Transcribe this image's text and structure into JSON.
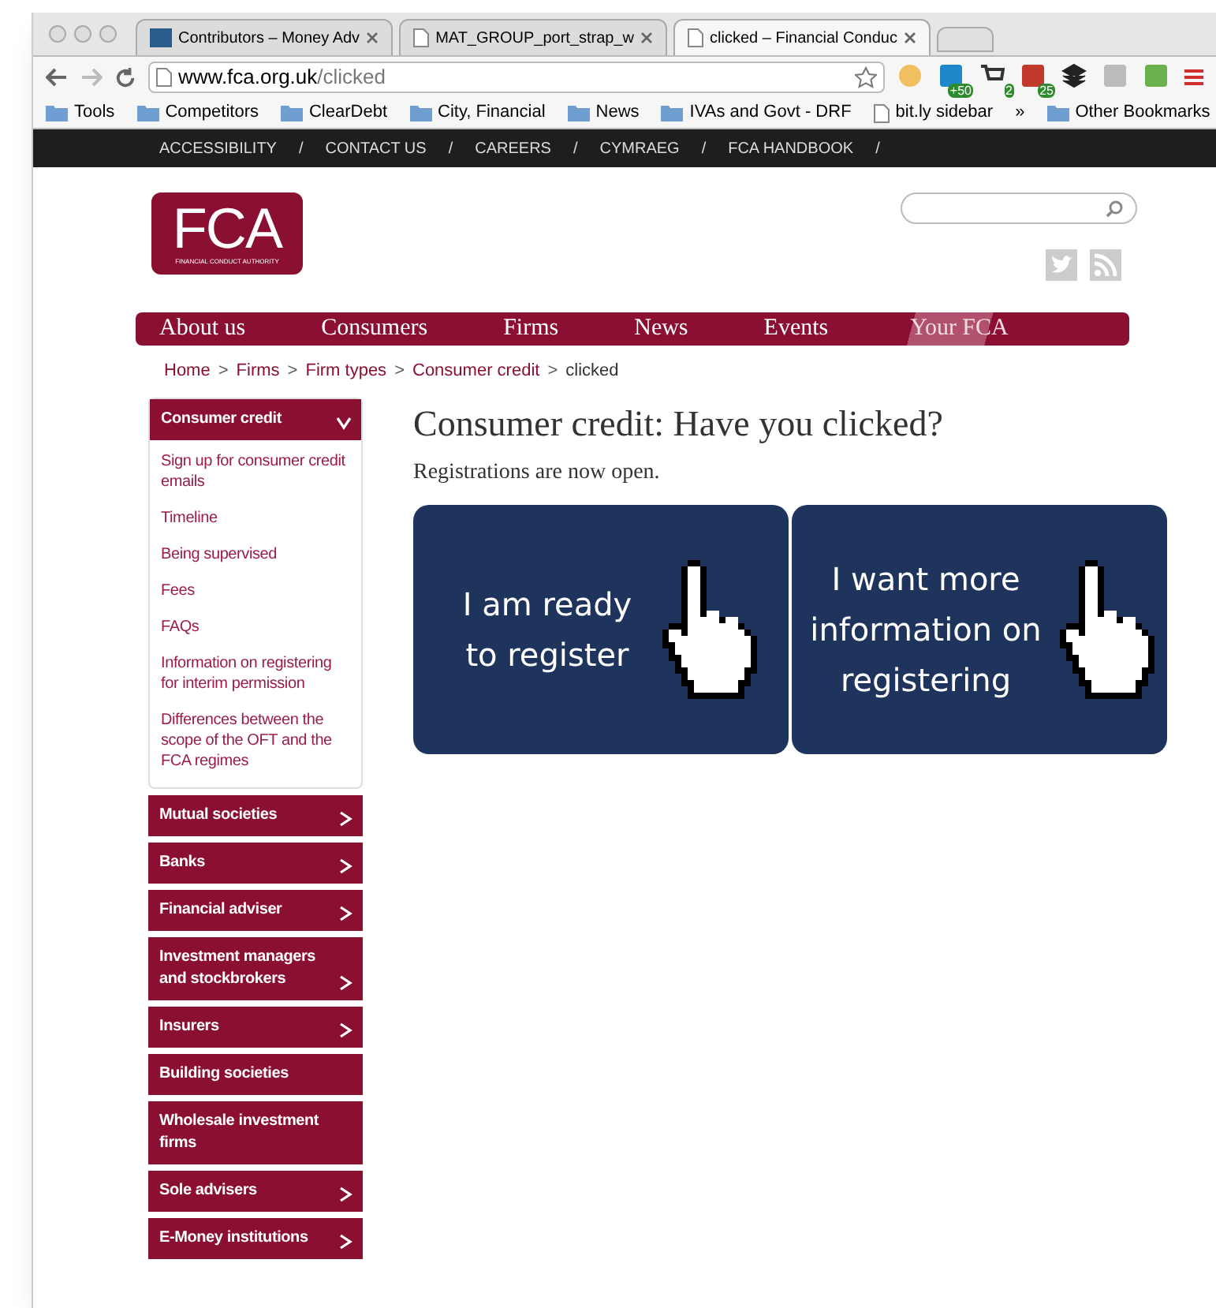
{
  "browser": {
    "tabs": [
      {
        "title": "Contributors – Money Adv",
        "selected": false
      },
      {
        "title": "MAT_GROUP_port_strap_w",
        "selected": false
      },
      {
        "title": "clicked – Financial Conduc",
        "selected": true
      }
    ],
    "url_host": "www.fca.org.uk",
    "url_path": "/clicked",
    "extensions": [
      {
        "kind": "face"
      },
      {
        "kind": "in",
        "badge": "+50"
      },
      {
        "kind": "cart",
        "badge": "2"
      },
      {
        "kind": "red",
        "badge": "25"
      },
      {
        "kind": "layers"
      },
      {
        "kind": "square"
      },
      {
        "kind": "green"
      }
    ],
    "bookmarks": [
      {
        "label": "Tools",
        "kind": "folder"
      },
      {
        "label": "Competitors",
        "kind": "folder"
      },
      {
        "label": "ClearDebt",
        "kind": "folder"
      },
      {
        "label": "City, Financial",
        "kind": "folder"
      },
      {
        "label": "News",
        "kind": "folder"
      },
      {
        "label": "IVAs and Govt - DRF",
        "kind": "folder"
      },
      {
        "label": "bit.ly sidebar",
        "kind": "page"
      }
    ],
    "more": "»",
    "other_bookmarks": "Other Bookmarks"
  },
  "top_links": [
    "ACCESSIBILITY",
    "CONTACT US",
    "CAREERS",
    "CYMRAEG",
    "FCA HANDBOOK"
  ],
  "separator": "/",
  "logo": {
    "letters": "FCA",
    "subtitle": "FINANCIAL CONDUCT AUTHORITY"
  },
  "main_nav": [
    {
      "label": "About us",
      "selected": false
    },
    {
      "label": "Consumers",
      "selected": false
    },
    {
      "label": "Firms",
      "selected": false
    },
    {
      "label": "News",
      "selected": false
    },
    {
      "label": "Events",
      "selected": false
    },
    {
      "label": "Your FCA",
      "selected": true
    }
  ],
  "breadcrumb": [
    "Home",
    "Firms",
    "Firm types",
    "Consumer credit",
    "clicked"
  ],
  "crumb_sep": ">",
  "sidebar": [
    {
      "label": "Consumer credit",
      "expanded": true,
      "arrow": true,
      "children": [
        "Sign up for consumer credit emails",
        "Timeline",
        "Being supervised",
        "Fees",
        "FAQs",
        "Information on registering for interim permission",
        "Differences between the scope of the OFT and the FCA regimes"
      ]
    },
    {
      "label": "Mutual societies",
      "expanded": false,
      "arrow": true
    },
    {
      "label": "Banks",
      "expanded": false,
      "arrow": true
    },
    {
      "label": "Financial adviser",
      "expanded": false,
      "arrow": true
    },
    {
      "label": "Investment managers and stockbrokers",
      "expanded": false,
      "arrow": true
    },
    {
      "label": "Insurers",
      "expanded": false,
      "arrow": true
    },
    {
      "label": "Building societies",
      "expanded": false,
      "arrow": false
    },
    {
      "label": "Wholesale investment firms",
      "expanded": false,
      "arrow": false
    },
    {
      "label": "Sole advisers",
      "expanded": false,
      "arrow": true
    },
    {
      "label": "E-Money institutions",
      "expanded": false,
      "arrow": true
    }
  ],
  "heading": "Consumer credit: Have you clicked?",
  "intro": "Registrations are now open.",
  "cta": [
    {
      "label": "I am ready to register"
    },
    {
      "label": "I want more information on registering"
    }
  ]
}
